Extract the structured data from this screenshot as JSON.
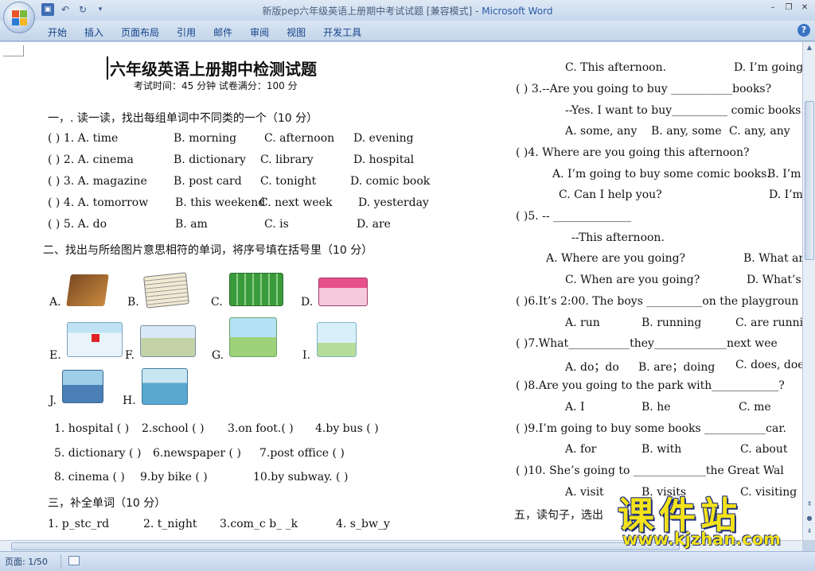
{
  "window": {
    "title": "新版pep六年级英语上册期中考试试题 [兼容模式] - ",
    "app_name": "Microsoft Word"
  },
  "ribbon": {
    "tabs": [
      "开始",
      "插入",
      "页面布局",
      "引用",
      "邮件",
      "审阅",
      "视图",
      "开发工具"
    ]
  },
  "status": {
    "page": "页面: 1/50"
  },
  "doc": {
    "title": "六年级英语上册期中检测试题",
    "subtitle": "考试时间：45 分钟  试卷满分：100 分",
    "s1_heading": "一，. 读一读，找出每组单词中不同类的一个（10 分）",
    "s1_rows": [
      [
        "(      ) 1. A. time",
        "B. morning",
        "C. afternoon",
        "D. evening"
      ],
      [
        "(      ) 2. A. cinema",
        "B. dictionary",
        "C. library",
        "D. hospital"
      ],
      [
        "(      ) 3. A. magazine",
        "B. post card",
        "C. tonight",
        "D. comic book"
      ],
      [
        "(      ) 4. A. tomorrow",
        "B. this weekend",
        "C. next week",
        "D. yesterday"
      ],
      [
        "(      ) 5. A. do",
        "B. am",
        "C. is",
        "D. are"
      ]
    ],
    "s2_heading": "二、找出与所给图片意思相符的单词，将序号填在括号里（10 分）",
    "pic_labels": [
      "A.",
      "B.",
      "C.",
      "D.",
      "E.",
      "F.",
      "G.",
      "I.",
      "J.",
      "H."
    ],
    "match_rows": [
      [
        "1. hospital (      )",
        "2.school (      )",
        "3.on foot.(      )",
        "4.by bus (      )"
      ],
      [
        "5. dictionary (      )",
        "6.newspaper (      )",
        "7.post office (      )",
        ""
      ],
      [
        "8. cinema (      )",
        "9.by bike (      )",
        "10.by subway. (      )",
        ""
      ]
    ],
    "s3_heading": "三，补全单词（10 分）",
    "s3_row": [
      "1.   p_stc_rd",
      "2.   t_night",
      "3.com_c   b_ _k",
      "4.   s_bw_y"
    ],
    "right": {
      "r1": [
        "C. This  afternoon.",
        "D. I’m going"
      ],
      "q3": "(        ) 3.--Are you going to buy  ___________books?",
      "q3b": "--Yes.  I want to buy__________  comic books.",
      "q3opts": [
        "A. some, any",
        "B. any, some",
        "C. any, any"
      ],
      "q4": "(        )4. Where are you going this afternoon?",
      "q4a": [
        "A. I’m going to buy some comic books.",
        "B. I’m"
      ],
      "q4c": [
        "C. Can I help you?",
        "D. I’m"
      ],
      "q5": "(        )5. --   ______________",
      "q5b": "--This  afternoon.",
      "q5a": [
        "A. Where are you going?",
        "B. What are"
      ],
      "q5c": [
        "C. When are you going?",
        "D. What’s y"
      ],
      "q6": "(        )6.It’s 2:00. The boys __________on the playgroun",
      "q6o": [
        "A. run",
        "B. running",
        "C. are running"
      ],
      "q7": "(        )7.What___________they_____________next wee",
      "q7o": [
        "A. do；do",
        "B. are；doing",
        "C. does, does"
      ],
      "q8": "(        )8.Are you going to the park with____________?",
      "q8o": [
        "A. I",
        "B. he",
        "C. me"
      ],
      "q9": "(        )9.I’m going to buy some books ___________car.",
      "q9o": [
        "A. for",
        "B. with",
        "C. about"
      ],
      "q10": "(        )10. She’s going to _____________the Great Wal",
      "q10o": [
        "A. visit",
        "B. visits",
        "C. visiting"
      ],
      "s5": "五，读句子，选出"
    }
  },
  "watermark": {
    "brand": "课件站",
    "url": "www.kjzhan.com"
  }
}
